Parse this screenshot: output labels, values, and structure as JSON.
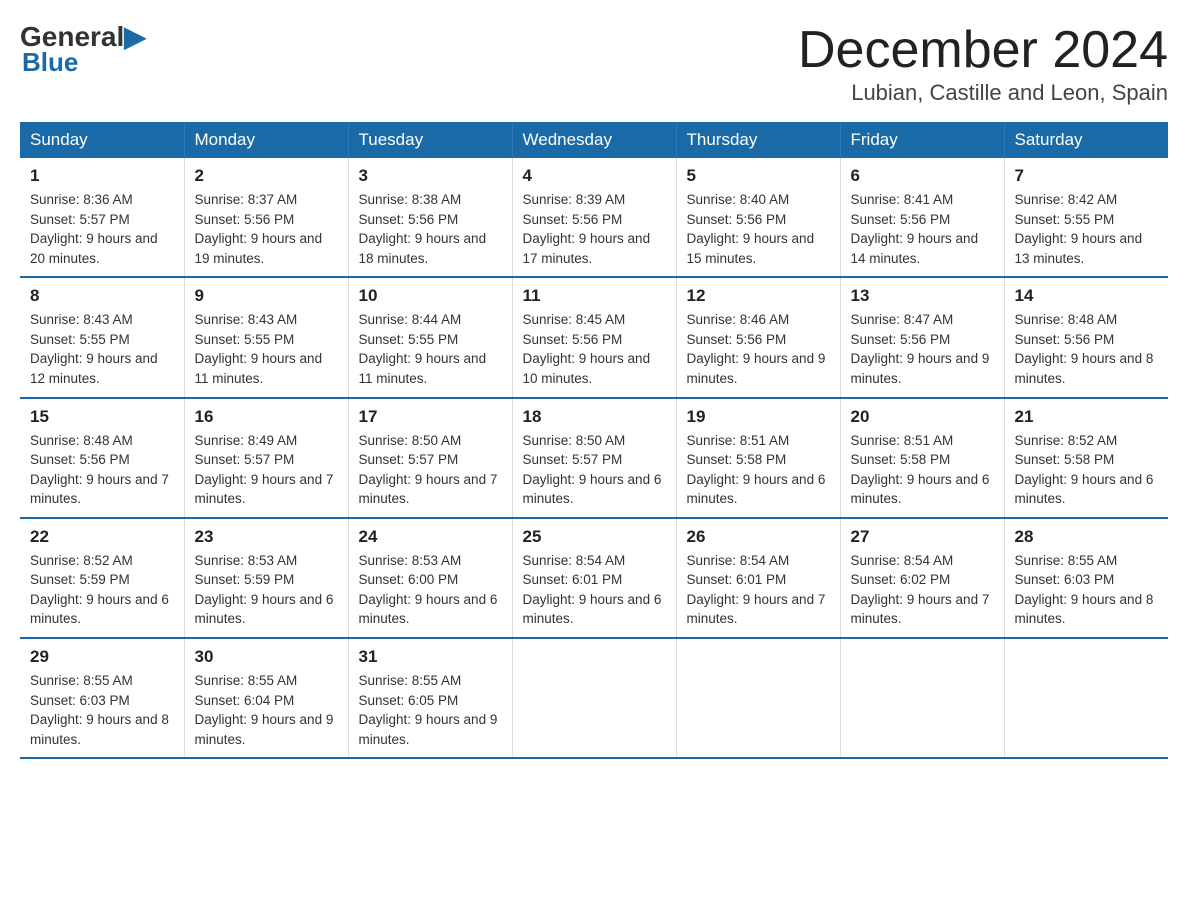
{
  "header": {
    "logo": {
      "general": "General",
      "blue": "Blue"
    },
    "title": "December 2024",
    "location": "Lubian, Castille and Leon, Spain"
  },
  "weekdays": [
    "Sunday",
    "Monday",
    "Tuesday",
    "Wednesday",
    "Thursday",
    "Friday",
    "Saturday"
  ],
  "weeks": [
    [
      {
        "day": "1",
        "sunrise": "8:36 AM",
        "sunset": "5:57 PM",
        "daylight": "9 hours and 20 minutes."
      },
      {
        "day": "2",
        "sunrise": "8:37 AM",
        "sunset": "5:56 PM",
        "daylight": "9 hours and 19 minutes."
      },
      {
        "day": "3",
        "sunrise": "8:38 AM",
        "sunset": "5:56 PM",
        "daylight": "9 hours and 18 minutes."
      },
      {
        "day": "4",
        "sunrise": "8:39 AM",
        "sunset": "5:56 PM",
        "daylight": "9 hours and 17 minutes."
      },
      {
        "day": "5",
        "sunrise": "8:40 AM",
        "sunset": "5:56 PM",
        "daylight": "9 hours and 15 minutes."
      },
      {
        "day": "6",
        "sunrise": "8:41 AM",
        "sunset": "5:56 PM",
        "daylight": "9 hours and 14 minutes."
      },
      {
        "day": "7",
        "sunrise": "8:42 AM",
        "sunset": "5:55 PM",
        "daylight": "9 hours and 13 minutes."
      }
    ],
    [
      {
        "day": "8",
        "sunrise": "8:43 AM",
        "sunset": "5:55 PM",
        "daylight": "9 hours and 12 minutes."
      },
      {
        "day": "9",
        "sunrise": "8:43 AM",
        "sunset": "5:55 PM",
        "daylight": "9 hours and 11 minutes."
      },
      {
        "day": "10",
        "sunrise": "8:44 AM",
        "sunset": "5:55 PM",
        "daylight": "9 hours and 11 minutes."
      },
      {
        "day": "11",
        "sunrise": "8:45 AM",
        "sunset": "5:56 PM",
        "daylight": "9 hours and 10 minutes."
      },
      {
        "day": "12",
        "sunrise": "8:46 AM",
        "sunset": "5:56 PM",
        "daylight": "9 hours and 9 minutes."
      },
      {
        "day": "13",
        "sunrise": "8:47 AM",
        "sunset": "5:56 PM",
        "daylight": "9 hours and 9 minutes."
      },
      {
        "day": "14",
        "sunrise": "8:48 AM",
        "sunset": "5:56 PM",
        "daylight": "9 hours and 8 minutes."
      }
    ],
    [
      {
        "day": "15",
        "sunrise": "8:48 AM",
        "sunset": "5:56 PM",
        "daylight": "9 hours and 7 minutes."
      },
      {
        "day": "16",
        "sunrise": "8:49 AM",
        "sunset": "5:57 PM",
        "daylight": "9 hours and 7 minutes."
      },
      {
        "day": "17",
        "sunrise": "8:50 AM",
        "sunset": "5:57 PM",
        "daylight": "9 hours and 7 minutes."
      },
      {
        "day": "18",
        "sunrise": "8:50 AM",
        "sunset": "5:57 PM",
        "daylight": "9 hours and 6 minutes."
      },
      {
        "day": "19",
        "sunrise": "8:51 AM",
        "sunset": "5:58 PM",
        "daylight": "9 hours and 6 minutes."
      },
      {
        "day": "20",
        "sunrise": "8:51 AM",
        "sunset": "5:58 PM",
        "daylight": "9 hours and 6 minutes."
      },
      {
        "day": "21",
        "sunrise": "8:52 AM",
        "sunset": "5:58 PM",
        "daylight": "9 hours and 6 minutes."
      }
    ],
    [
      {
        "day": "22",
        "sunrise": "8:52 AM",
        "sunset": "5:59 PM",
        "daylight": "9 hours and 6 minutes."
      },
      {
        "day": "23",
        "sunrise": "8:53 AM",
        "sunset": "5:59 PM",
        "daylight": "9 hours and 6 minutes."
      },
      {
        "day": "24",
        "sunrise": "8:53 AM",
        "sunset": "6:00 PM",
        "daylight": "9 hours and 6 minutes."
      },
      {
        "day": "25",
        "sunrise": "8:54 AM",
        "sunset": "6:01 PM",
        "daylight": "9 hours and 6 minutes."
      },
      {
        "day": "26",
        "sunrise": "8:54 AM",
        "sunset": "6:01 PM",
        "daylight": "9 hours and 7 minutes."
      },
      {
        "day": "27",
        "sunrise": "8:54 AM",
        "sunset": "6:02 PM",
        "daylight": "9 hours and 7 minutes."
      },
      {
        "day": "28",
        "sunrise": "8:55 AM",
        "sunset": "6:03 PM",
        "daylight": "9 hours and 8 minutes."
      }
    ],
    [
      {
        "day": "29",
        "sunrise": "8:55 AM",
        "sunset": "6:03 PM",
        "daylight": "9 hours and 8 minutes."
      },
      {
        "day": "30",
        "sunrise": "8:55 AM",
        "sunset": "6:04 PM",
        "daylight": "9 hours and 9 minutes."
      },
      {
        "day": "31",
        "sunrise": "8:55 AM",
        "sunset": "6:05 PM",
        "daylight": "9 hours and 9 minutes."
      },
      null,
      null,
      null,
      null
    ]
  ]
}
